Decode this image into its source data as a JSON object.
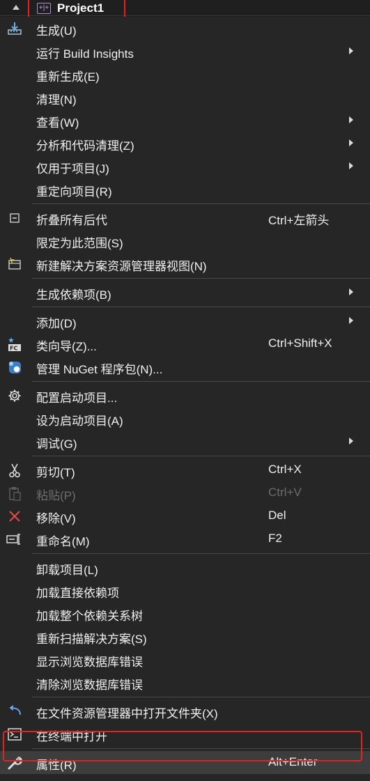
{
  "header": {
    "title": "Project1",
    "icon_text": "+|+"
  },
  "colors": {
    "highlight_border": "#e52222",
    "menu_bg": "#262626",
    "text": "#f0f0f0",
    "disabled_text": "#6d6d6d"
  },
  "menu": {
    "build": "生成(U)",
    "build_insights": "运行 Build Insights",
    "rebuild": "重新生成(E)",
    "clean": "清理(N)",
    "view": "查看(W)",
    "analyze": "分析和代码清理(Z)",
    "project_only": "仅用于项目(J)",
    "retarget": "重定向项目(R)",
    "collapse": "折叠所有后代",
    "collapse_shortcut": "Ctrl+左箭头",
    "scope": "限定为此范围(S)",
    "new_view": "新建解决方案资源管理器视图(N)",
    "build_deps": "生成依赖项(B)",
    "add": "添加(D)",
    "class_wizard": "类向导(Z)...",
    "class_wizard_shortcut": "Ctrl+Shift+X",
    "nuget": "管理 NuGet 程序包(N)...",
    "startup_config": "配置启动项目...",
    "set_startup": "设为启动项目(A)",
    "debug": "调试(G)",
    "cut": "剪切(T)",
    "cut_shortcut": "Ctrl+X",
    "paste": "粘贴(P)",
    "paste_shortcut": "Ctrl+V",
    "remove": "移除(V)",
    "remove_shortcut": "Del",
    "rename": "重命名(M)",
    "rename_shortcut": "F2",
    "unload": "卸载项目(L)",
    "load_direct": "加载直接依赖项",
    "load_tree": "加载整个依赖关系树",
    "rescan": "重新扫描解决方案(S)",
    "show_db_errors": "显示浏览数据库错误",
    "clear_db_errors": "清除浏览数据库错误",
    "open_in_explorer": "在文件资源管理器中打开文件夹(X)",
    "open_in_terminal": "在终端中打开",
    "properties": "属性(R)",
    "properties_shortcut": "Alt+Enter"
  }
}
